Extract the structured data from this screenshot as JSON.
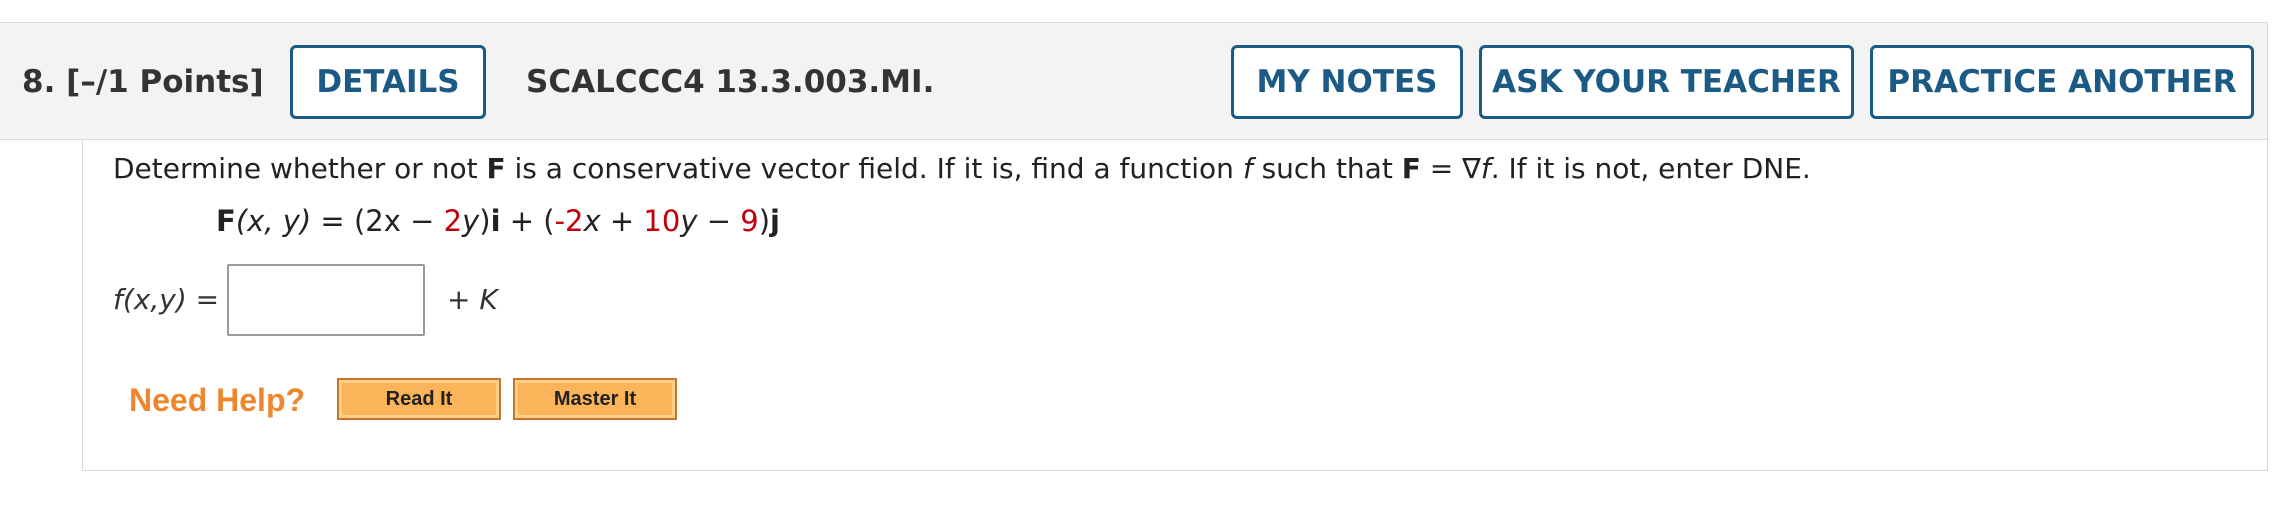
{
  "question": {
    "number": "8.",
    "points": "[–/1 Points]",
    "code": "SCALCCC4 13.3.003.MI."
  },
  "buttons": {
    "details": "DETAILS",
    "my_notes": "MY NOTES",
    "ask_teacher": "ASK YOUR TEACHER",
    "practice_another": "PRACTICE ANOTHER"
  },
  "prompt": {
    "p1": "Determine whether or not ",
    "bold_F": "F",
    "p2": " is a conservative vector field. If it is, find a function ",
    "italic_f": "f",
    "p3": " such that ",
    "bold_F2": "F",
    "p4": " = ∇",
    "italic_f2": "f",
    "p5": ". If it is not, enter DNE."
  },
  "formula": {
    "F": "F",
    "args": "(x, y)",
    "eq_open": " = (2x − ",
    "c1": "2",
    "v1": "y",
    "close1": ")",
    "i": "i",
    "plus_open": " + (",
    "c2": "-2",
    "v2": "x",
    "plus": " + ",
    "c3": "10",
    "v3": "y",
    "minus": " − ",
    "c4": "9",
    "close2": ")",
    "j": "j"
  },
  "answer": {
    "label": "f(x,y)  =",
    "value": "",
    "suffix": "+ K"
  },
  "help": {
    "label": "Need Help?",
    "read_it": "Read It",
    "master_it": "Master It"
  }
}
